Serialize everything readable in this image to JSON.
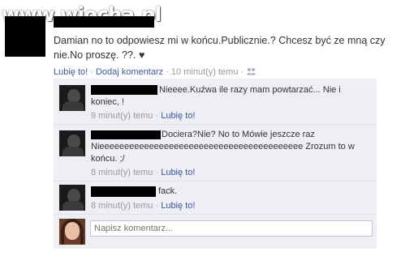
{
  "watermark": "www.wiocha.pl",
  "post": {
    "text_line1": "Damian no to odpowiesz mi w końcu.Publicznie.? Chcesz być ze mną czy",
    "text_line2": "nie.No proszę. ??.",
    "heart": "♥",
    "actions": {
      "like": "Lubię to!",
      "sep1": " · ",
      "comment": "Dodaj komentarz",
      "sep2": " · ",
      "time": "10 minut(y) temu",
      "sep3": " · "
    }
  },
  "comments": [
    {
      "text_line1": "Nieeee.Kuźwa ile razy mam powtarzać... Nie i",
      "text_line2": "koniec, !",
      "time": "9 minut(y) temu",
      "sep": " · ",
      "like": "Lubię to!"
    },
    {
      "text_line1": "Dociera?Nie? No to Mówie jeszcze raz",
      "text_line2": "Nieeeeeeeeeeeeeeeeeeeeeeeeeeeeeeeeeeeeeeeee Zrozum to w",
      "text_line3": "końcu. ;/",
      "time": "8 minut(y) temu",
      "sep": " · ",
      "like": "Lubię to!"
    },
    {
      "text_line1": "fack.",
      "time": "8 minut(y) temu",
      "sep": " · ",
      "like": "Lubię to!"
    }
  ],
  "comment_input": {
    "placeholder": "Napisz komentarz..."
  },
  "colors": {
    "link": "#3b5998",
    "comment_bg": "#edeff4",
    "muted": "#999999"
  }
}
